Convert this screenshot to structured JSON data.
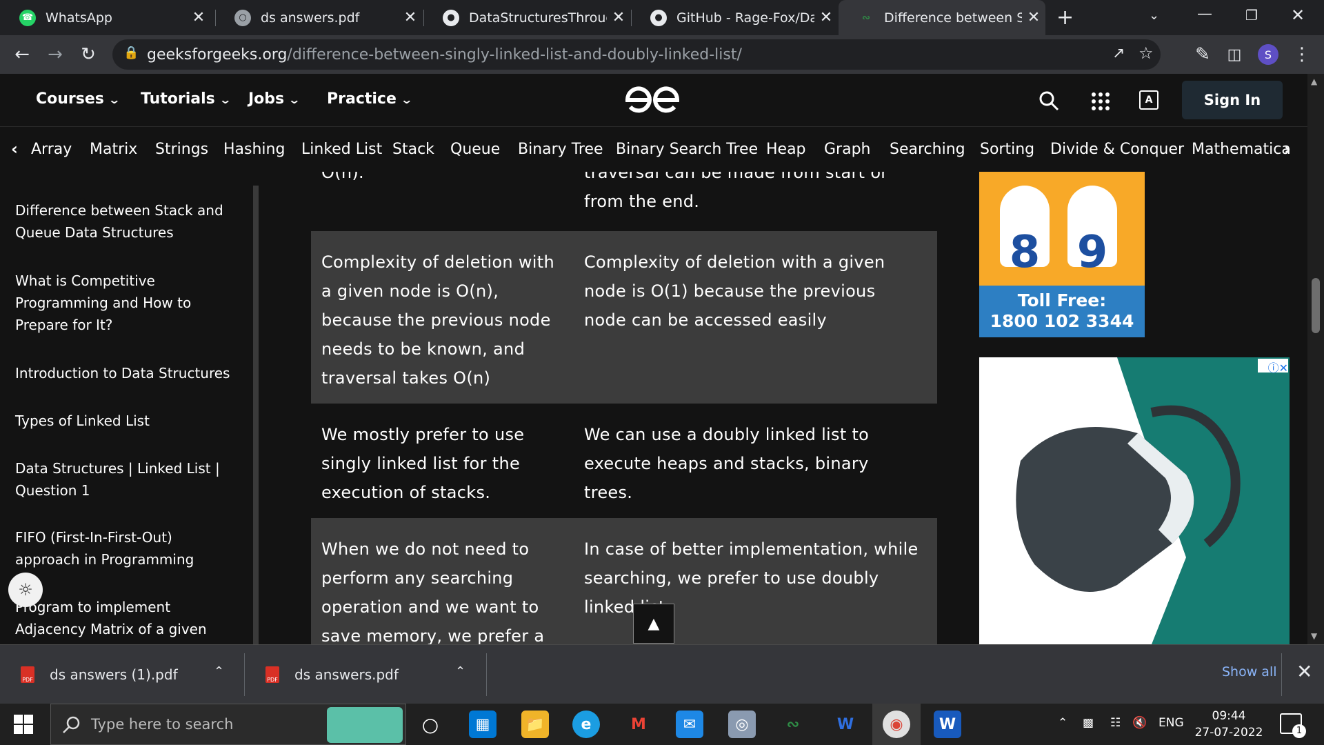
{
  "browser": {
    "tabs": [
      {
        "title": "WhatsApp",
        "icon": "whatsapp-icon"
      },
      {
        "title": "ds answers.pdf",
        "icon": "globe-icon"
      },
      {
        "title": "DataStructuresThroughC/",
        "icon": "github-icon"
      },
      {
        "title": "GitHub - Rage-Fox/DataS",
        "icon": "github-icon"
      },
      {
        "title": "Difference between Singly",
        "icon": "gfg-icon",
        "active": true
      }
    ],
    "url_host": "geeksforgeeks.org",
    "url_path": "/difference-between-singly-linked-list-and-doubly-linked-list/",
    "profile_initial": "S"
  },
  "site": {
    "menus": [
      "Courses",
      "Tutorials",
      "Jobs",
      "Practice"
    ],
    "signin_label": "Sign In",
    "topics": [
      "Array",
      "Matrix",
      "Strings",
      "Hashing",
      "Linked List",
      "Stack",
      "Queue",
      "Binary Tree",
      "Binary Search Tree",
      "Heap",
      "Graph",
      "Searching",
      "Sorting",
      "Divide & Conquer",
      "Mathematica"
    ]
  },
  "sidebar": {
    "links": [
      "Difference between Stack and Queue Data Structures",
      "What is Competitive Programming and How to Prepare for It?",
      "Introduction to Data Structures",
      "Types of Linked List",
      "Data Structures | Linked List | Question 1",
      "FIFO (First-In-First-Out) approach in Programming",
      "Program to implement Adjacency Matrix of a given"
    ]
  },
  "table": {
    "partial_top_left": "O(n).",
    "partial_top_right": "traversal can be made from start or from the end.",
    "rows": [
      {
        "left": "Complexity of deletion with a given node is O(n), because the previous node needs to be known, and traversal takes O(n)",
        "right": "Complexity of deletion with a given node is O(1) because the previous node can be accessed easily"
      },
      {
        "left": "We mostly prefer to use singly linked list for the execution of stacks.",
        "right": "We can use a doubly linked list to execute heaps and stacks, binary trees."
      },
      {
        "left": "When we do not need to perform any searching operation and we want to save memory, we prefer a singly",
        "right": "In case of better implementation, while searching, we prefer to use doubly linked list."
      }
    ]
  },
  "ads": {
    "toll_free_label": "Toll Free:",
    "toll_free_number": "1800 102 3344",
    "rank_digits": [
      "8",
      "9"
    ]
  },
  "downloads": {
    "items": [
      "ds answers (1).pdf",
      "ds answers.pdf"
    ],
    "show_all": "Show all"
  },
  "taskbar": {
    "search_placeholder": "Type here to search",
    "language": "ENG",
    "time": "09:44",
    "date": "27-07-2022",
    "notification_count": "1"
  },
  "colors": {
    "page_bg": "#131313",
    "row_shade": "#3c3c3c",
    "link_blue": "#8ab4f8",
    "ad_orange": "#f8a928",
    "ad_blue": "#2d7fc3"
  }
}
